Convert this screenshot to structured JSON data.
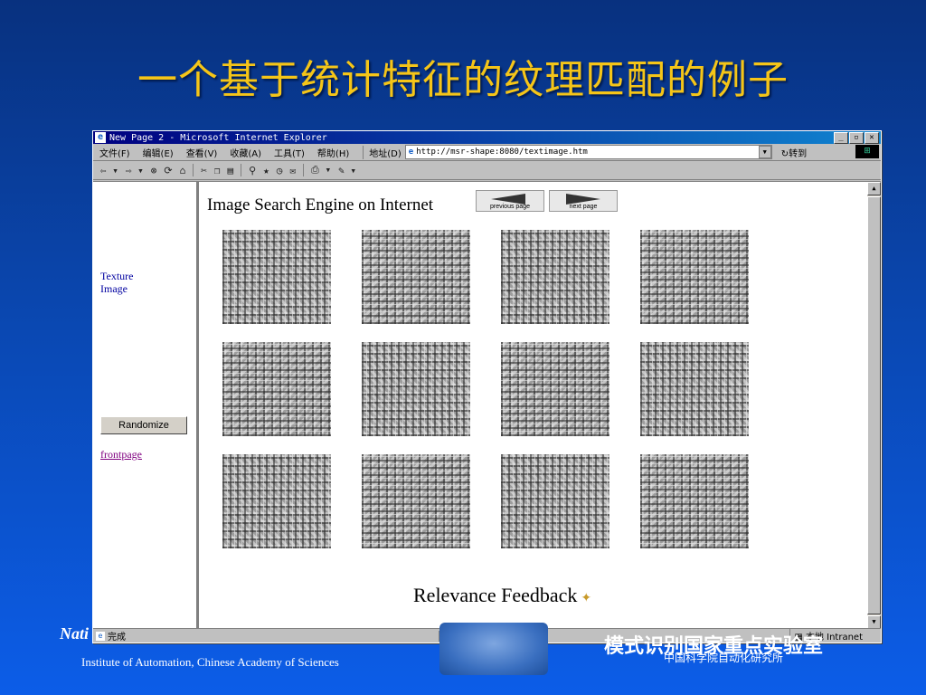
{
  "slide": {
    "title": "一个基于统计特征的纹理匹配的例子",
    "footer_left": "Nati",
    "footer_institute": "Institute of Automation, Chinese Academy of Sciences",
    "footer_right": "模式识别国家重点实验室",
    "footer_cas": "中国科学院自动化研究所"
  },
  "browser": {
    "window_title": "New Page 2 - Microsoft Internet Explorer",
    "window_buttons": [
      "_",
      "▫",
      "✕"
    ],
    "menu": [
      "文件(F)",
      "编辑(E)",
      "查看(V)",
      "收藏(A)",
      "工具(T)",
      "帮助(H)"
    ],
    "address_label": "地址(D)",
    "address_url": "http://msr-shape:8080/textimage.htm",
    "go_label": "转到",
    "status_text": "完成",
    "status_zone": "本地 Intranet"
  },
  "left_frame": {
    "texture_link": "Texture Image",
    "randomize_button": "Randomize",
    "frontpage_link": "frontpage"
  },
  "main_frame": {
    "heading": "Image Search Engine on Internet",
    "previous_button": "previous page",
    "next_button": "next page",
    "relevance_feedback": "Relevance Feedback"
  },
  "icons": {
    "toolbar": [
      "back-icon",
      "forward-icon",
      "stop-icon",
      "refresh-icon",
      "home-icon",
      "cut-icon",
      "copy-icon",
      "paste-icon",
      "search-icon",
      "favorites-icon",
      "history-icon",
      "mail-icon",
      "print-icon",
      "edit-icon"
    ]
  },
  "colors": {
    "title": "#f5c518",
    "background_top": "#08317f",
    "background_bottom": "#0c5de8",
    "link": "#0000a0",
    "visited_link": "#800080"
  }
}
